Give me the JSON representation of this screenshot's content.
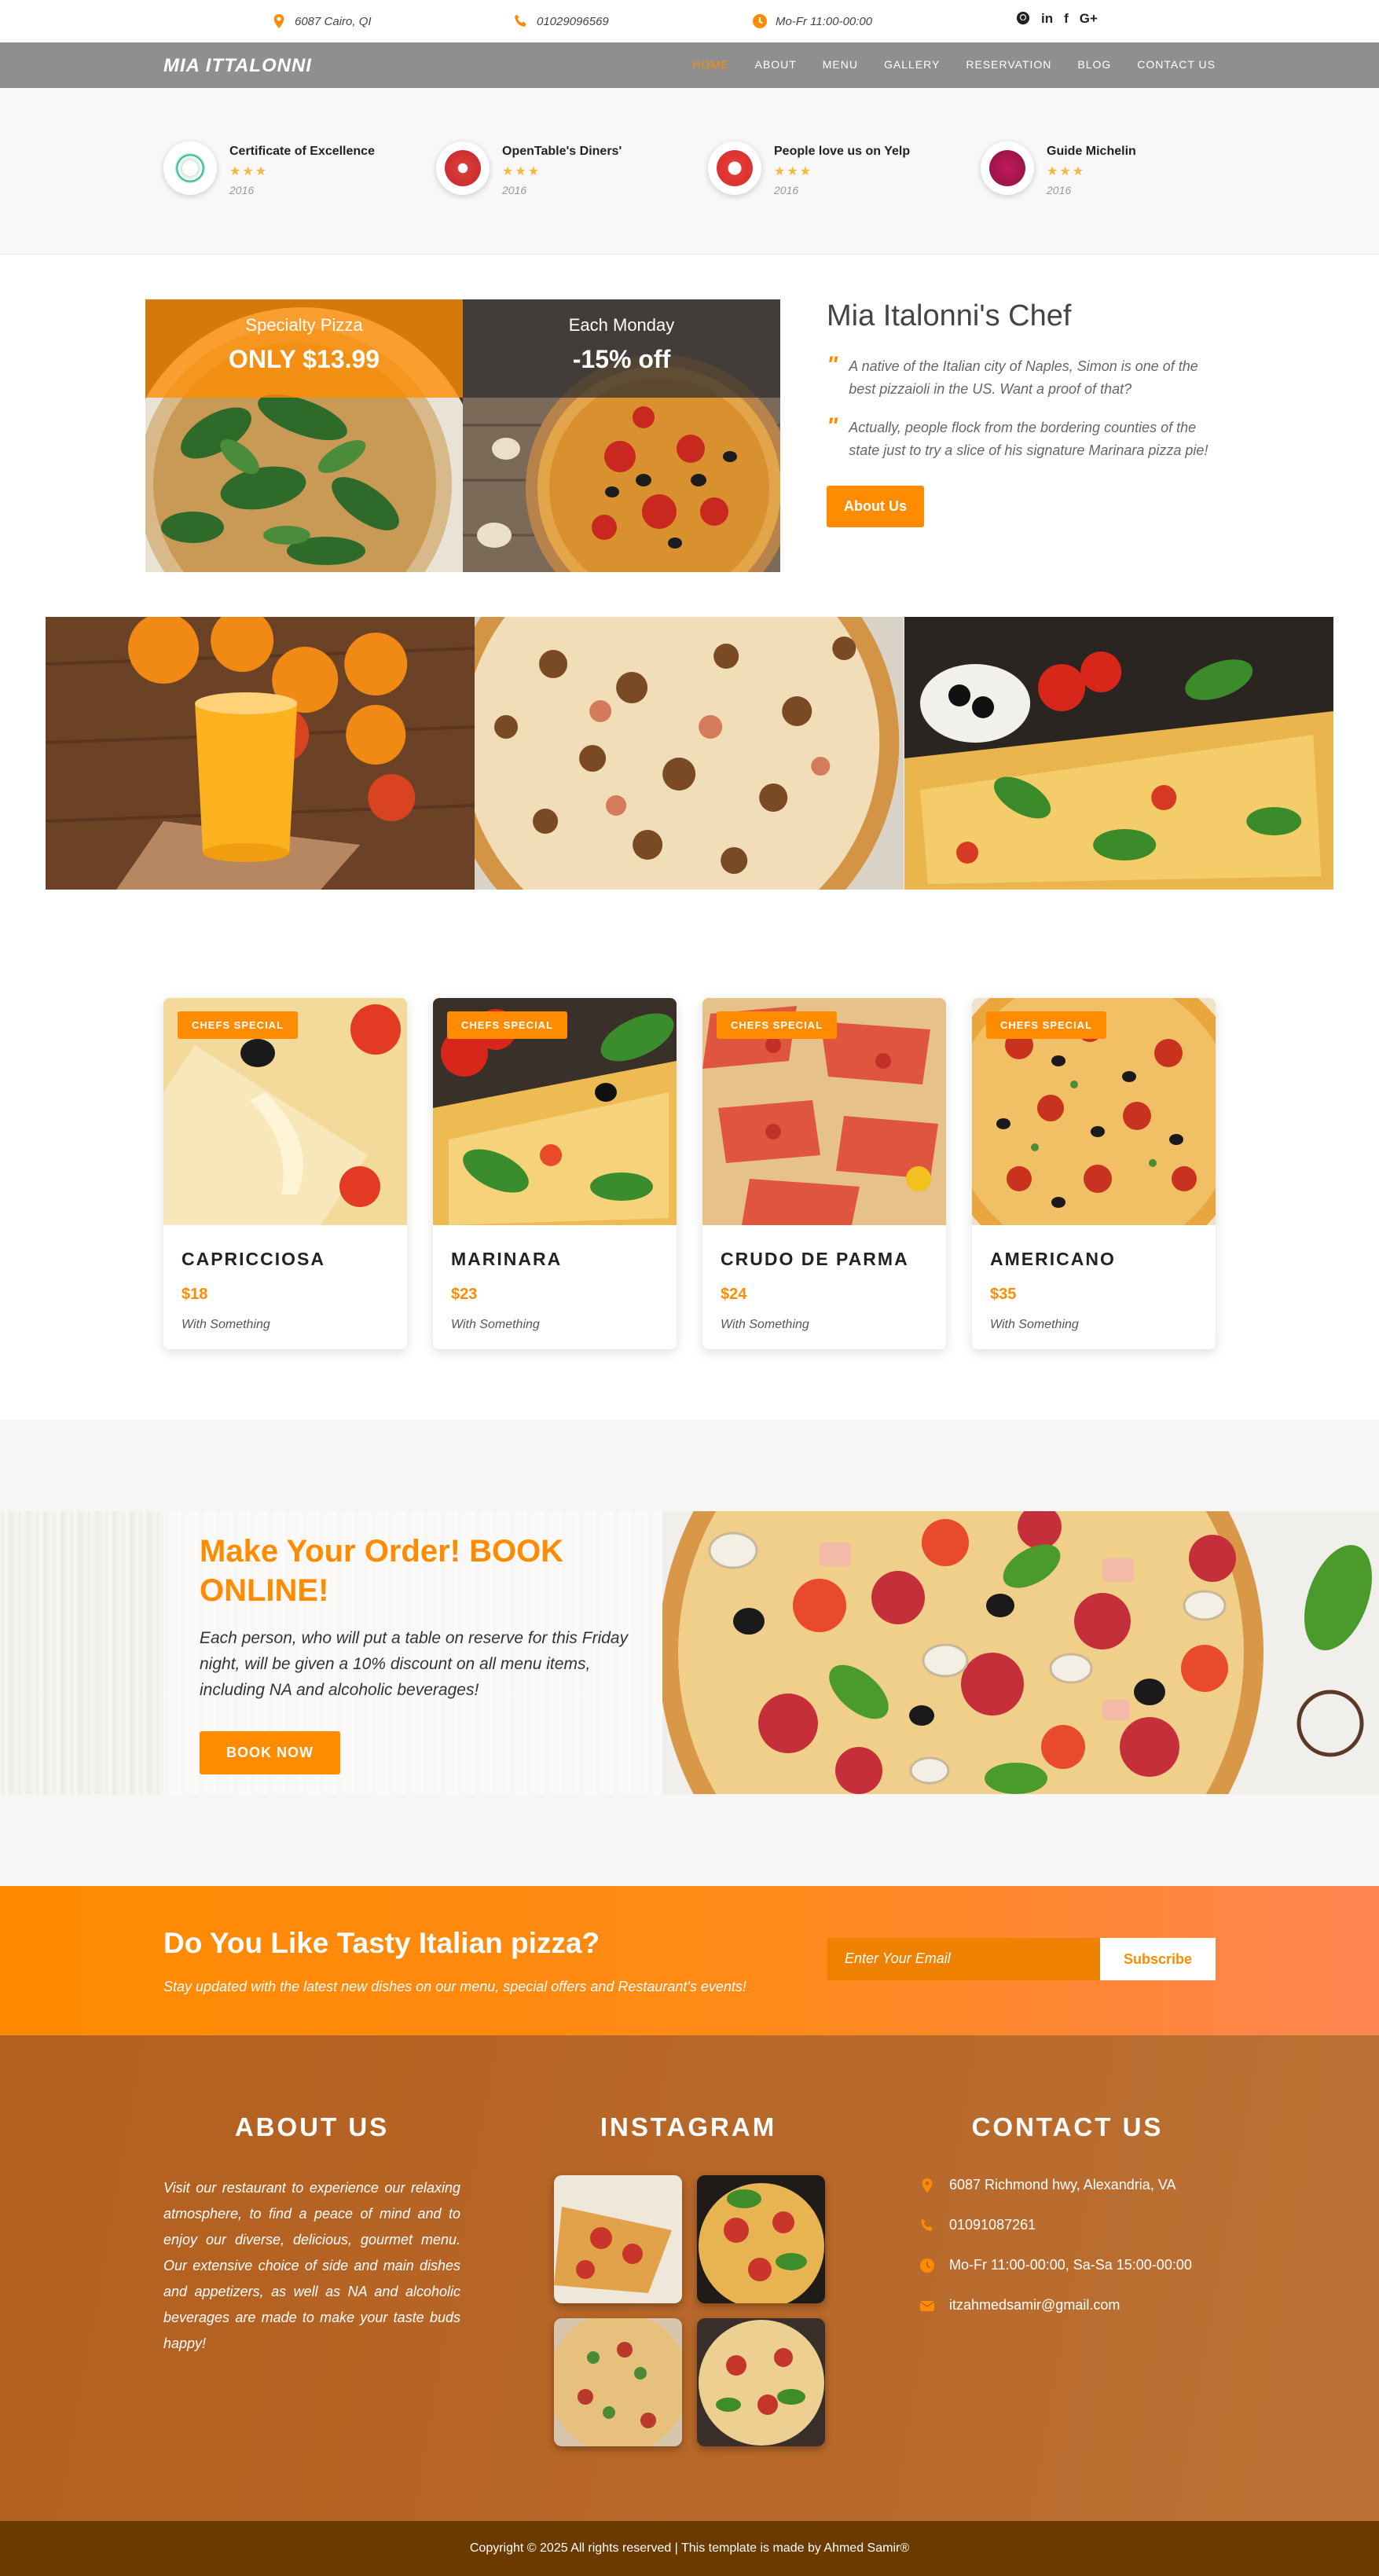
{
  "topbar": {
    "address": "6087 Cairo, QI",
    "phone": "01029096569",
    "hours": "Mo-Fr 11:00-00:00",
    "social": [
      "github-icon",
      "linkedin-icon",
      "facebook-icon",
      "google-plus-icon"
    ]
  },
  "nav": {
    "brand": "MIA ITTALONNI",
    "items": [
      "HOME",
      "ABOUT",
      "MENU",
      "GALLERY",
      "RESERVATION",
      "BLOG",
      "CONTACT US"
    ],
    "active": "HOME"
  },
  "awards": [
    {
      "title": "Certificate of Excellence",
      "stars": "★★★",
      "year": "2016",
      "icon": "tripadvisor-badge-icon"
    },
    {
      "title": "OpenTable's Diners'",
      "stars": "★★★",
      "year": "2016",
      "icon": "opentable-badge-icon"
    },
    {
      "title": "People love us on Yelp",
      "stars": "★★★",
      "year": "2016",
      "icon": "yelp-badge-icon"
    },
    {
      "title": "Guide Michelin",
      "stars": "★★★",
      "year": "2016",
      "icon": "michelin-badge-icon"
    }
  ],
  "promos": [
    {
      "label": "Specialty Pizza",
      "offer": "ONLY $13.99"
    },
    {
      "label": "Each Monday",
      "offer": "-15% off"
    }
  ],
  "chef": {
    "title": "Mia Italonni's Chef",
    "quote_mark": "\"",
    "quotes": [
      "A native of the Italian city of Naples, Simon is one of the best pizzaioli in the US. Want a proof of that?",
      "Actually, people flock from the bordering counties of the state just to try a slice of his signature Marinara pizza pie!"
    ],
    "button": "About Us"
  },
  "menu_cards": [
    {
      "tag": "CHEFS SPECIAL",
      "name": "CAPRICCIOSA",
      "price": "$18",
      "sub": "With Something"
    },
    {
      "tag": "CHEFS SPECIAL",
      "name": "MARINARA",
      "price": "$23",
      "sub": "With Something"
    },
    {
      "tag": "CHEFS SPECIAL",
      "name": "CRUDO DE PARMA",
      "price": "$24",
      "sub": "With Something"
    },
    {
      "tag": "CHEFS SPECIAL",
      "name": "AMERICANO",
      "price": "$35",
      "sub": "With Something"
    }
  ],
  "order": {
    "title": "Make Your Order! BOOK ONLINE!",
    "text": "Each person, who will put a table on reserve for this Friday night, will be given a 10% discount on all menu items, including NA and alcoholic beverages!",
    "button": "BOOK NOW"
  },
  "newsletter": {
    "title": "Do You Like Tasty Italian pizza?",
    "text": "Stay updated with the latest new dishes on our menu, special offers and Restaurant's events!",
    "placeholder": "Enter Your Email",
    "button": "Subscribe"
  },
  "footer": {
    "about_title": "ABOUT US",
    "about_text": "Visit our restaurant to experience our relaxing atmosphere, to find a peace of mind and to enjoy our diverse, delicious, gourmet menu. Our extensive choice of side and main dishes and appetizers, as well as NA and alcoholic beverages are made to make your taste buds happy!",
    "instagram_title": "INSTAGRAM",
    "contact_title": "CONTACT US",
    "contact": [
      {
        "icon": "location-pin-icon",
        "text": "6087 Richmond hwy, Alexandria, VA"
      },
      {
        "icon": "phone-icon",
        "text": "01091087261"
      },
      {
        "icon": "clock-icon",
        "text": "Mo-Fr 11:00-00:00, Sa-Sa 15:00-00:00"
      },
      {
        "icon": "envelope-icon",
        "text": "itzahmedsamir@gmail.com"
      }
    ],
    "copyright": "Copyright © 2025 All rights reserved | This template is made by Ahmed Samir®"
  },
  "colors": {
    "accent": "#ff8c00",
    "nav": "#8f8f8f",
    "footer": "#b8692b",
    "copyright_bar": "#6b3a00"
  }
}
